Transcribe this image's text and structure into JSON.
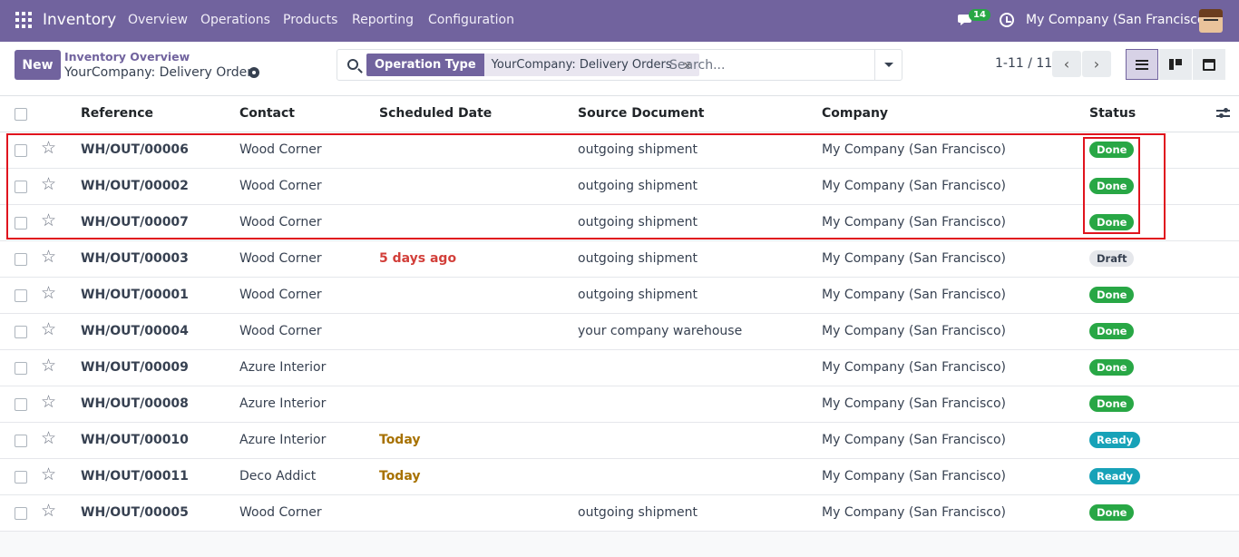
{
  "navbar": {
    "app_name": "Inventory",
    "menu": [
      "Overview",
      "Operations",
      "Products",
      "Reporting",
      "Configuration"
    ],
    "chat_count": "14",
    "company": "My Company (San Francisco)"
  },
  "control": {
    "new_label": "New",
    "breadcrumb_parent": "Inventory Overview",
    "breadcrumb_current": "YourCompany: Delivery Orders",
    "facet_label": "Operation Type",
    "facet_value": "YourCompany: Delivery Orders",
    "facet_remove": "×",
    "search_placeholder": "Search...",
    "pager": "1-11 / 11"
  },
  "columns": [
    "Reference",
    "Contact",
    "Scheduled Date",
    "Source Document",
    "Company",
    "Status"
  ],
  "colors": {
    "brand": "#71639e",
    "done": "#28a745",
    "ready": "#17a2b8",
    "draft": "#e5e7eb",
    "highlight": "#e0141e"
  },
  "rows": [
    {
      "ref": "WH/OUT/00006",
      "contact": "Wood Corner",
      "date": "",
      "date_style": "",
      "source": "outgoing shipment",
      "company": "My Company (San Francisco)",
      "status": "Done"
    },
    {
      "ref": "WH/OUT/00002",
      "contact": "Wood Corner",
      "date": "",
      "date_style": "",
      "source": "outgoing shipment",
      "company": "My Company (San Francisco)",
      "status": "Done"
    },
    {
      "ref": "WH/OUT/00007",
      "contact": "Wood Corner",
      "date": "",
      "date_style": "",
      "source": "outgoing shipment",
      "company": "My Company (San Francisco)",
      "status": "Done"
    },
    {
      "ref": "WH/OUT/00003",
      "contact": "Wood Corner",
      "date": "5 days ago",
      "date_style": "late",
      "source": "outgoing shipment",
      "company": "My Company (San Francisco)",
      "status": "Draft"
    },
    {
      "ref": "WH/OUT/00001",
      "contact": "Wood Corner",
      "date": "",
      "date_style": "",
      "source": "outgoing shipment",
      "company": "My Company (San Francisco)",
      "status": "Done"
    },
    {
      "ref": "WH/OUT/00004",
      "contact": "Wood Corner",
      "date": "",
      "date_style": "",
      "source": "your company warehouse",
      "company": "My Company (San Francisco)",
      "status": "Done"
    },
    {
      "ref": "WH/OUT/00009",
      "contact": "Azure Interior",
      "date": "",
      "date_style": "",
      "source": "",
      "company": "My Company (San Francisco)",
      "status": "Done"
    },
    {
      "ref": "WH/OUT/00008",
      "contact": "Azure Interior",
      "date": "",
      "date_style": "",
      "source": "",
      "company": "My Company (San Francisco)",
      "status": "Done"
    },
    {
      "ref": "WH/OUT/00010",
      "contact": "Azure Interior",
      "date": "Today",
      "date_style": "today",
      "source": "",
      "company": "My Company (San Francisco)",
      "status": "Ready"
    },
    {
      "ref": "WH/OUT/00011",
      "contact": "Deco Addict",
      "date": "Today",
      "date_style": "today",
      "source": "",
      "company": "My Company (San Francisco)",
      "status": "Ready"
    },
    {
      "ref": "WH/OUT/00005",
      "contact": "Wood Corner",
      "date": "",
      "date_style": "",
      "source": "outgoing shipment",
      "company": "My Company (San Francisco)",
      "status": "Done"
    }
  ]
}
